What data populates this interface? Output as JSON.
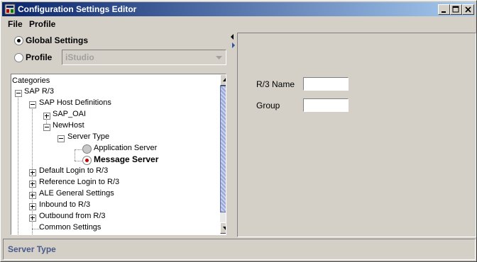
{
  "window": {
    "title": "Configuration Settings Editor",
    "controls": [
      "minimize",
      "maximize",
      "close"
    ]
  },
  "menu": {
    "file": "File",
    "profile": "Profile"
  },
  "left_panel": {
    "global_settings_label": "Global Settings",
    "profile_label": "Profile",
    "profile_combo_value": "iStudio",
    "selected_scope": "Global Settings",
    "tree": {
      "header": "Categories",
      "nodes": [
        {
          "label": "SAP R/3",
          "state": "expanded"
        },
        {
          "label": "SAP Host Definitions",
          "state": "expanded"
        },
        {
          "label": "SAP_OAI",
          "state": "collapsed"
        },
        {
          "label": "NewHost",
          "state": "expanded"
        },
        {
          "label": "Server Type",
          "state": "expanded"
        },
        {
          "label": "Application Server",
          "state": "option",
          "checked": false
        },
        {
          "label": "Message Server",
          "state": "option",
          "checked": true
        },
        {
          "label": "Default Login to R/3",
          "state": "collapsed"
        },
        {
          "label": "Reference Login to R/3",
          "state": "collapsed"
        },
        {
          "label": "ALE General Settings",
          "state": "collapsed"
        },
        {
          "label": "Inbound to R/3",
          "state": "collapsed"
        },
        {
          "label": "Outbound from R/3",
          "state": "collapsed"
        },
        {
          "label": "Common Settings",
          "state": "leaf"
        }
      ]
    }
  },
  "right_panel": {
    "r3_name_label": "R/3 Name",
    "r3_name_value": "",
    "group_label": "Group",
    "group_value": ""
  },
  "status": {
    "text": "Server Type"
  },
  "colors": {
    "titlebar_start": "#0a246a",
    "titlebar_end": "#a6caf0",
    "status_text": "#4a5a8a",
    "scroll_thumb": "#9aa8d8",
    "radio_checked": "#c00000"
  }
}
